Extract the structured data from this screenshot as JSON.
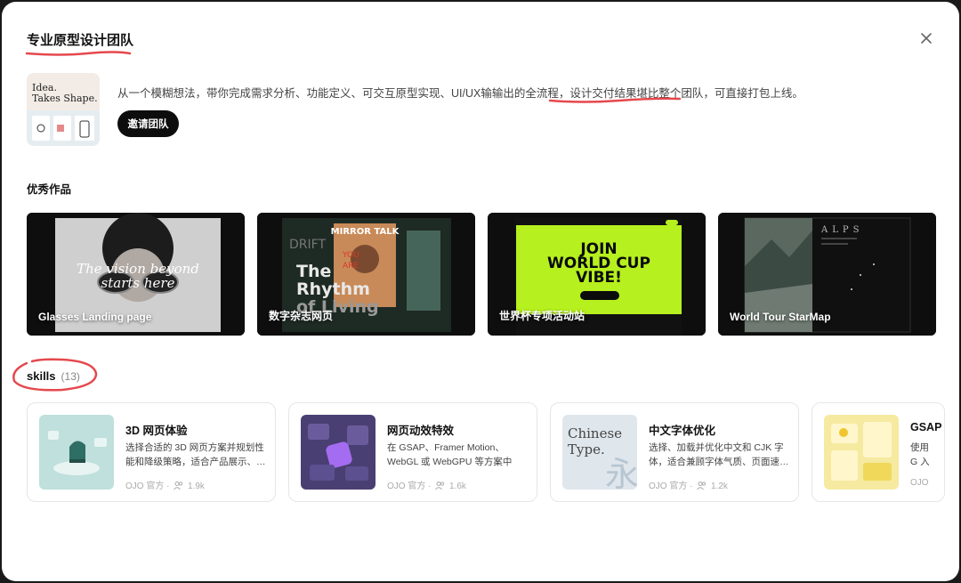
{
  "dialog": {
    "title": "专业原型设计团队",
    "description": "从一个模糊想法，带你完成需求分析、功能定义、可交互原型实现、UI/UX输输出的全流程，设计交付结果堪比整个团队，可直接打包上线。",
    "invite_label": "邀请团队",
    "team_thumb_text": "Idea.\nTakes Shape."
  },
  "works": {
    "section_title": "优秀作品",
    "items": [
      {
        "label": "Glasses Landing page",
        "overlay": "The vision beyond starts here"
      },
      {
        "label": "数字杂志网页",
        "overlay": "The Rhythm of Living",
        "overlay2": "MIRROR TALK",
        "overlay3": "DRIFT"
      },
      {
        "label": "世界杯专项活动站",
        "overlay": "JOIN WORLD CUP VIBE!"
      },
      {
        "label": "World Tour StarMap",
        "overlay": "ALPS"
      }
    ]
  },
  "skills": {
    "title": "skills",
    "count": "(13)",
    "items": [
      {
        "name": "3D 网页体验",
        "desc": "选择合适的 3D 网页方案并规划性能和降级策略，适合产品展示、…",
        "author": "OJO 官方 ·",
        "users": "1.9k"
      },
      {
        "name": "网页动效特效",
        "desc": "在 GSAP、Framer Motion、WebGL 或 WebGPU 等方案中选…",
        "author": "OJO 官方 ·",
        "users": "1.6k"
      },
      {
        "name": "中文字体优化",
        "desc": "选择、加载并优化中文和 CJK 字体，适合兼顾字体气质、页面速…",
        "author": "OJO 官方 ·",
        "users": "1.2k",
        "img_text": "Chinese Type."
      },
      {
        "name": "GSAP",
        "desc": "使用 G 入场动",
        "author": "OJO",
        "users": ""
      }
    ]
  },
  "colors": {
    "accent_red": "#e5484d",
    "button_bg": "#0d0d0d",
    "worldcup_green": "#b6f01e"
  }
}
